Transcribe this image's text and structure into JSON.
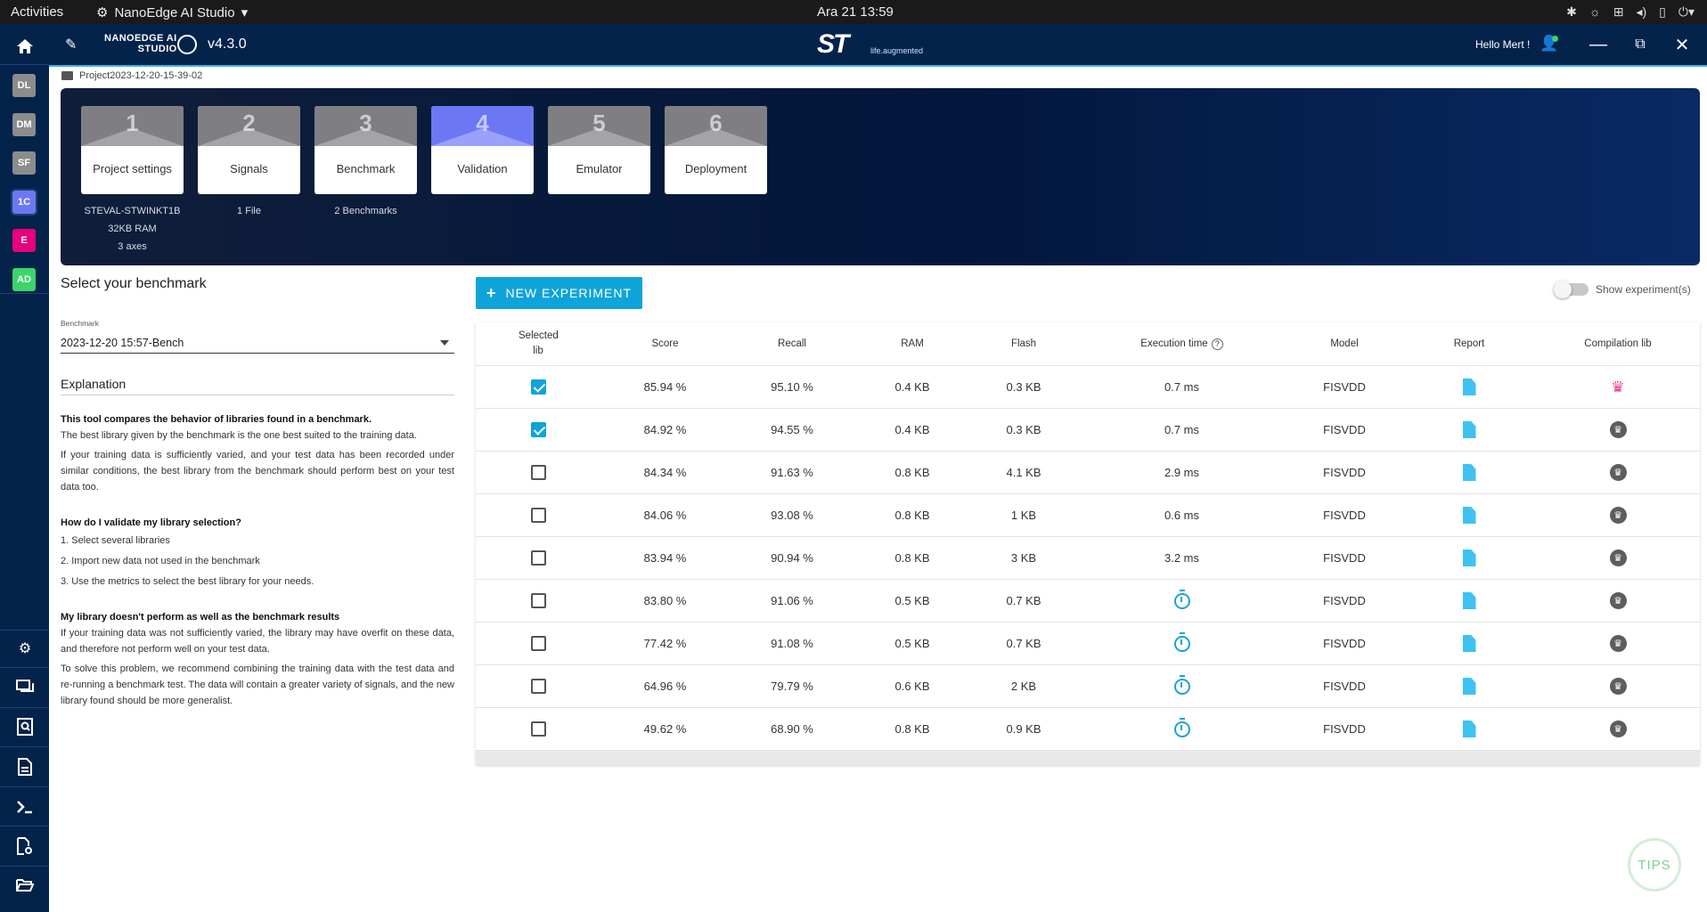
{
  "system_bar": {
    "activities": "Activities",
    "app_name": "NanoEdge AI Studio",
    "clock": "Ara 21  13:59"
  },
  "rail": {
    "items": [
      {
        "label": "DL",
        "color": "#8c8c8c"
      },
      {
        "label": "DM",
        "color": "#8c8c8c"
      },
      {
        "label": "SF",
        "color": "#8c8c8c"
      },
      {
        "label": "1C",
        "color": "#6e77f3"
      },
      {
        "label": "E",
        "color": "#e6007e"
      },
      {
        "label": "AD",
        "color": "#3cd46b"
      }
    ]
  },
  "header": {
    "brand_line1": "NANOEDGE AI",
    "brand_line2": "STUDIO",
    "version": "v4.3.0",
    "st_logo": "ST",
    "st_tagline": "life.augmented",
    "greeting": "Hello Mert !"
  },
  "breadcrumb": "Project2023-12-20-15-39-02",
  "steps": [
    {
      "num": "1",
      "label": "Project settings",
      "sub": [
        "STEVAL-STWINKT1B",
        "32KB RAM",
        "3 axes"
      ]
    },
    {
      "num": "2",
      "label": "Signals",
      "sub": [
        "1 File"
      ]
    },
    {
      "num": "3",
      "label": "Benchmark",
      "sub": [
        "2 Benchmarks"
      ]
    },
    {
      "num": "4",
      "label": "Validation",
      "sub": []
    },
    {
      "num": "5",
      "label": "Emulator",
      "sub": []
    },
    {
      "num": "6",
      "label": "Deployment",
      "sub": []
    }
  ],
  "left": {
    "title": "Select your benchmark",
    "benchmark_label": "Benchmark",
    "benchmark_value": "2023-12-20 15:57-Bench",
    "explanation_title": "Explanation",
    "p1_bold": "This tool compares the behavior of libraries found in a benchmark.",
    "p1": "The best library given by the benchmark is the one best suited to the training data.",
    "p2": "If your training data is sufficiently varied, and your test data has been recorded under similar conditions, the best library from the benchmark should perform best on your test data too.",
    "q1_bold": "How do I validate my library selection?",
    "steps": [
      "1. Select several libraries",
      "2. Import new data not used in the benchmark",
      "3. Use the metrics to select the best library for your needs."
    ],
    "q2_bold": "My library doesn't perform as well as the benchmark results",
    "p3": "If your training data was not sufficiently varied, the library may have overfit on these data, and therefore not perform well on your test data.",
    "p4": "To solve this problem, we recommend combining the training data with the test data and re-running a benchmark test. The data will contain a greater variety of signals, and the new library found should be more generalist."
  },
  "toolbar": {
    "new_experiment": "NEW EXPERIMENT",
    "show_experiments": "Show experiment(s)"
  },
  "table": {
    "headers": {
      "selected": "Selected lib",
      "score": "Score",
      "recall": "Recall",
      "ram": "RAM",
      "flash": "Flash",
      "exec_time": "Execution time",
      "model": "Model",
      "report": "Report",
      "compilation": "Compilation lib"
    },
    "rows": [
      {
        "checked": true,
        "score": "85.94 %",
        "recall": "95.10 %",
        "ram": "0.4 KB",
        "flash": "0.3 KB",
        "exec": "0.7 ms",
        "model": "FISVDD",
        "crown": "pink"
      },
      {
        "checked": true,
        "score": "84.92 %",
        "recall": "94.55 %",
        "ram": "0.4 KB",
        "flash": "0.3 KB",
        "exec": "0.7 ms",
        "model": "FISVDD",
        "crown": "grey"
      },
      {
        "checked": false,
        "score": "84.34 %",
        "recall": "91.63 %",
        "ram": "0.8 KB",
        "flash": "4.1 KB",
        "exec": "2.9 ms",
        "model": "FISVDD",
        "crown": "grey"
      },
      {
        "checked": false,
        "score": "84.06 %",
        "recall": "93.08 %",
        "ram": "0.8 KB",
        "flash": "1 KB",
        "exec": "0.6 ms",
        "model": "FISVDD",
        "crown": "grey"
      },
      {
        "checked": false,
        "score": "83.94 %",
        "recall": "90.94 %",
        "ram": "0.8 KB",
        "flash": "3 KB",
        "exec": "3.2 ms",
        "model": "FISVDD",
        "crown": "grey"
      },
      {
        "checked": false,
        "score": "83.80 %",
        "recall": "91.06 %",
        "ram": "0.5 KB",
        "flash": "0.7 KB",
        "exec": "",
        "model": "FISVDD",
        "crown": "grey"
      },
      {
        "checked": false,
        "score": "77.42 %",
        "recall": "91.08 %",
        "ram": "0.5 KB",
        "flash": "0.7 KB",
        "exec": "",
        "model": "FISVDD",
        "crown": "grey"
      },
      {
        "checked": false,
        "score": "64.96 %",
        "recall": "79.79 %",
        "ram": "0.6 KB",
        "flash": "2 KB",
        "exec": "",
        "model": "FISVDD",
        "crown": "grey"
      },
      {
        "checked": false,
        "score": "49.62 %",
        "recall": "68.90 %",
        "ram": "0.8 KB",
        "flash": "0.9 KB",
        "exec": "",
        "model": "FISVDD",
        "crown": "grey"
      }
    ]
  },
  "tips": "TIPS"
}
